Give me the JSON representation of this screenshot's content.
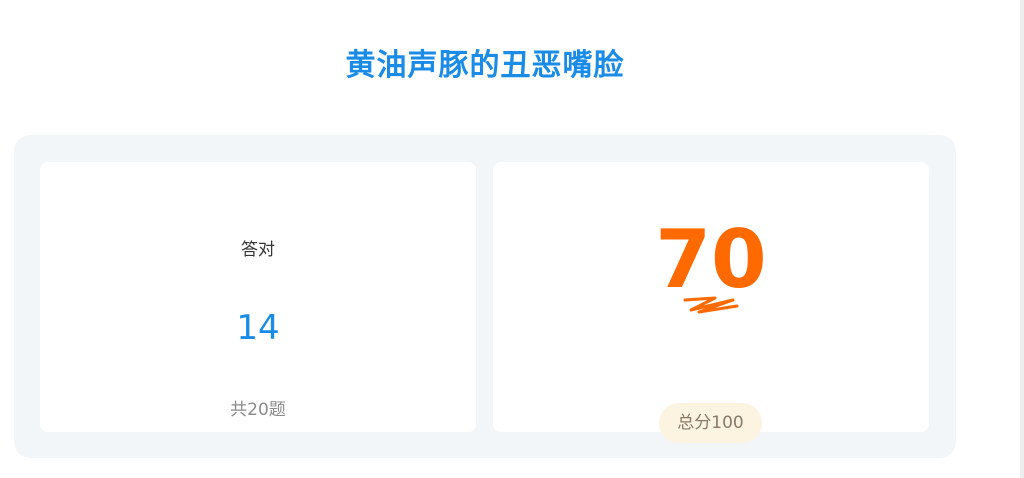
{
  "header": {
    "title": "黄油声豚的丑恶嘴脸"
  },
  "result": {
    "correct_label": "答对",
    "correct_count": "14",
    "total_questions_text": "共20题",
    "score": "70",
    "total_score_text": "总分100"
  },
  "colors": {
    "accent_blue": "#1a8ce8",
    "score_orange": "#ff6a00",
    "badge_bg": "#fdf3e1",
    "panel_bg": "#f3f6f9"
  }
}
